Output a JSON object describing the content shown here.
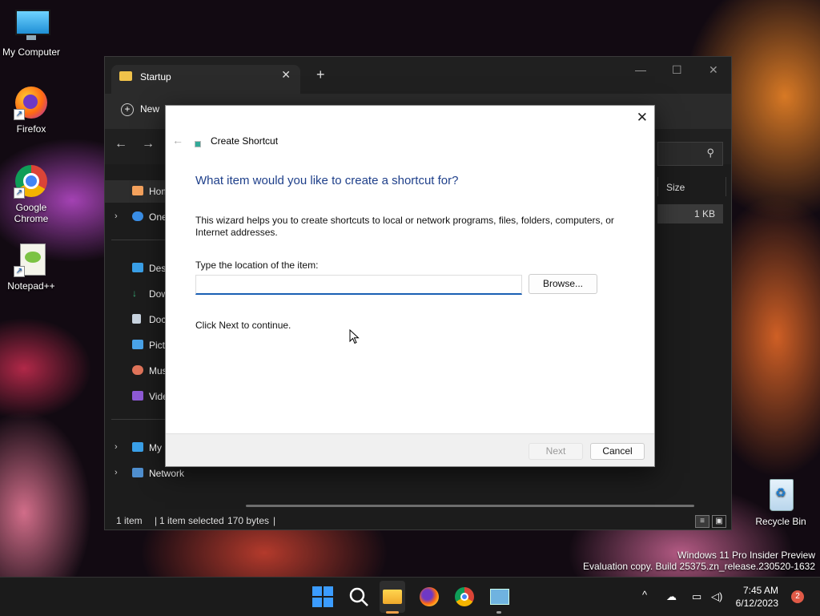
{
  "desktop": {
    "icons": [
      {
        "label": "My Computer",
        "icon": "monitor-icon"
      },
      {
        "label": "Firefox",
        "icon": "firefox-icon"
      },
      {
        "label": "Google Chrome",
        "icon": "chrome-icon"
      },
      {
        "label": "Notepad++",
        "icon": "notepadpp-icon"
      },
      {
        "label": "Recycle Bin",
        "icon": "recycle-bin-icon"
      }
    ],
    "watermark_line1": "Windows 11 Pro Insider Preview",
    "watermark_line2": "Evaluation copy. Build 25375.zn_release.230520-1632"
  },
  "explorer": {
    "tab_title": "Startup",
    "tab_close": "✕",
    "new_tab": "+",
    "toolbar_new": "New",
    "back": "←",
    "forward": "→",
    "sidebar": [
      {
        "label": "Home",
        "icon": "home-icon"
      },
      {
        "label": "OneDrive",
        "icon": "cloud-icon"
      },
      {
        "label": "Desktop",
        "icon": "desktop-icon"
      },
      {
        "label": "Downloads",
        "icon": "download-icon"
      },
      {
        "label": "Documents",
        "icon": "document-icon"
      },
      {
        "label": "Pictures",
        "icon": "pictures-icon"
      },
      {
        "label": "Music",
        "icon": "music-icon"
      },
      {
        "label": "Videos",
        "icon": "videos-icon"
      },
      {
        "label": "My Computer",
        "icon": "monitor-icon"
      },
      {
        "label": "Network",
        "icon": "network-icon"
      }
    ],
    "column_size": "Size",
    "file_size": "1 KB",
    "status_count": "1 item",
    "status_selected": "1 item selected",
    "status_bytes": "170 bytes"
  },
  "dialog": {
    "title": "Create Shortcut",
    "close": "✕",
    "back": "←",
    "heading": "What item would you like to create a shortcut for?",
    "description": "This wizard helps you to create shortcuts to local or network programs, files, folders, computers, or Internet addresses.",
    "location_label": "Type the location of the item:",
    "location_value": "",
    "browse_label": "Browse...",
    "hint": "Click Next to continue.",
    "next_label": "Next",
    "cancel_label": "Cancel"
  },
  "taskbar": {
    "clock_time": "7:45 AM",
    "clock_date": "6/12/2023",
    "notification_count": "2",
    "tray_chevron": "^",
    "colors": {
      "start": "#3b9cff",
      "active_indicator": "#f0a04b"
    }
  }
}
